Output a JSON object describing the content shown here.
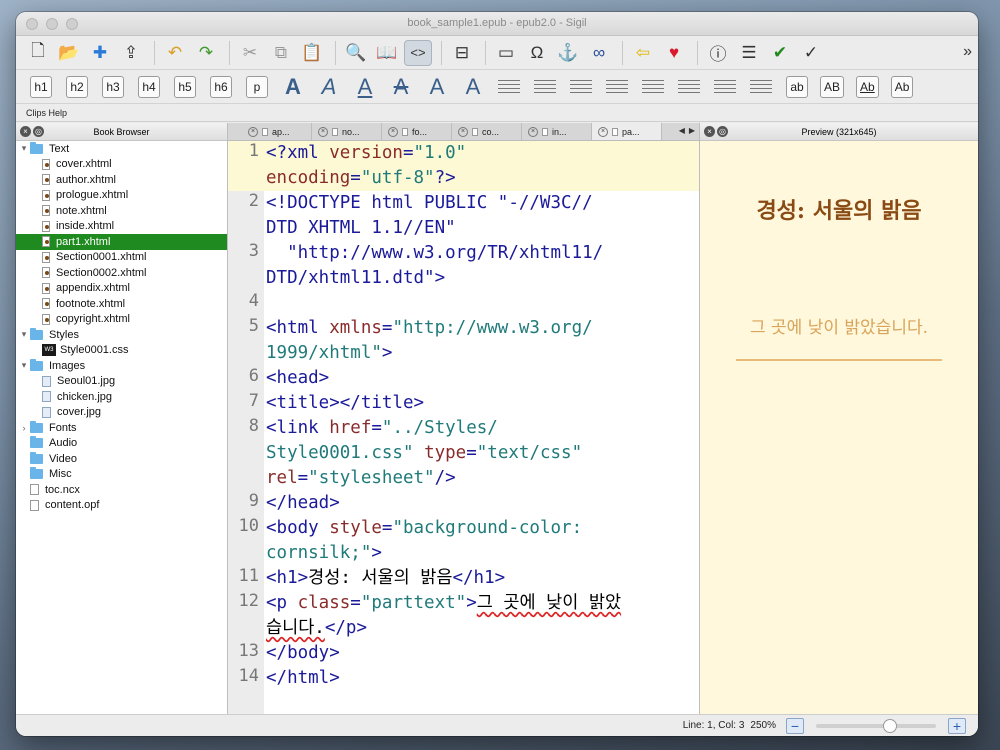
{
  "window": {
    "title": "book_sample1.epub - epub2.0 - Sigil"
  },
  "toolbar1": {
    "icons": [
      "new-file",
      "open-folder",
      "add-existing",
      "save",
      "undo",
      "redo",
      "cut",
      "copy",
      "paste",
      "find",
      "book-view",
      "code-view",
      "split-view",
      "insert-image",
      "special-char",
      "anchor",
      "link",
      "back-arrow",
      "heart",
      "metadata",
      "toc",
      "spellcheck",
      "validate"
    ],
    "active": "code-view",
    "overflow": "»"
  },
  "toolbar2": {
    "headings": [
      "h1",
      "h2",
      "h3",
      "h4",
      "h5",
      "h6",
      "p"
    ],
    "case_buttons": [
      "ab",
      "AB",
      "Ab",
      "Ab"
    ]
  },
  "clips_help": "Clips Help",
  "book_browser": {
    "title": "Book Browser",
    "tree": [
      {
        "label": "Text",
        "type": "folder",
        "expanded": true,
        "level": 0
      },
      {
        "label": "cover.xhtml",
        "type": "xhtml",
        "level": 1
      },
      {
        "label": "author.xhtml",
        "type": "xhtml",
        "level": 1
      },
      {
        "label": "prologue.xhtml",
        "type": "xhtml",
        "level": 1
      },
      {
        "label": "note.xhtml",
        "type": "xhtml",
        "level": 1
      },
      {
        "label": "inside.xhtml",
        "type": "xhtml",
        "level": 1
      },
      {
        "label": "part1.xhtml",
        "type": "xhtml",
        "level": 1,
        "selected": true
      },
      {
        "label": "Section0001.xhtml",
        "type": "xhtml",
        "level": 1
      },
      {
        "label": "Section0002.xhtml",
        "type": "xhtml",
        "level": 1
      },
      {
        "label": "appendix.xhtml",
        "type": "xhtml",
        "level": 1
      },
      {
        "label": "footnote.xhtml",
        "type": "xhtml",
        "level": 1
      },
      {
        "label": "copyright.xhtml",
        "type": "xhtml",
        "level": 1
      },
      {
        "label": "Styles",
        "type": "folder",
        "expanded": true,
        "level": 0
      },
      {
        "label": "Style0001.css",
        "type": "css",
        "level": 1
      },
      {
        "label": "Images",
        "type": "folder",
        "expanded": true,
        "level": 0
      },
      {
        "label": "Seoul01.jpg",
        "type": "image",
        "level": 1
      },
      {
        "label": "chicken.jpg",
        "type": "image",
        "level": 1
      },
      {
        "label": "cover.jpg",
        "type": "image",
        "level": 1
      },
      {
        "label": "Fonts",
        "type": "folder",
        "expanded": false,
        "level": 0
      },
      {
        "label": "Audio",
        "type": "folder",
        "level": 0
      },
      {
        "label": "Video",
        "type": "folder",
        "level": 0
      },
      {
        "label": "Misc",
        "type": "folder",
        "level": 0
      },
      {
        "label": "toc.ncx",
        "type": "file",
        "level": 0
      },
      {
        "label": "content.opf",
        "type": "file",
        "level": 0
      }
    ]
  },
  "editor": {
    "tabs": [
      "ap...",
      "no...",
      "fo...",
      "co...",
      "in...",
      "pa..."
    ],
    "active_tab": 5,
    "lines": [
      {
        "n": "1",
        "highlight": true,
        "segs": [
          [
            "tag",
            "<?xml "
          ],
          [
            "attr",
            "version"
          ],
          [
            "tag",
            "="
          ],
          [
            "val",
            "\"1.0\""
          ],
          [
            "plain",
            "\n"
          ],
          [
            "attr",
            "encoding"
          ],
          [
            "tag",
            "="
          ],
          [
            "val",
            "\"utf-8\""
          ],
          [
            "tag",
            "?>"
          ]
        ]
      },
      {
        "n": "2",
        "segs": [
          [
            "tag",
            "<!DOCTYPE html PUBLIC \"-//W3C//\nDTD XHTML 1.1//EN\""
          ]
        ]
      },
      {
        "n": "3",
        "segs": [
          [
            "tag",
            "  \"http://www.w3.org/TR/xhtml11/\nDTD/xhtml11.dtd\">"
          ]
        ]
      },
      {
        "n": "4",
        "segs": [
          [
            "plain",
            " "
          ]
        ]
      },
      {
        "n": "5",
        "segs": [
          [
            "tag",
            "<html "
          ],
          [
            "attr",
            "xmlns"
          ],
          [
            "tag",
            "="
          ],
          [
            "val",
            "\"http://www.w3.org/\n1999/xhtml\""
          ],
          [
            "tag",
            ">"
          ]
        ]
      },
      {
        "n": "6",
        "segs": [
          [
            "tag",
            "<head>"
          ]
        ]
      },
      {
        "n": "7",
        "segs": [
          [
            "tag",
            "<title></title>"
          ]
        ]
      },
      {
        "n": "8",
        "segs": [
          [
            "tag",
            "<link "
          ],
          [
            "attr",
            "href"
          ],
          [
            "tag",
            "="
          ],
          [
            "val",
            "\"../Styles/\nStyle0001.css\""
          ],
          [
            "tag",
            " "
          ],
          [
            "attr",
            "type"
          ],
          [
            "tag",
            "="
          ],
          [
            "val",
            "\"text/css\""
          ],
          [
            "plain",
            "\n"
          ],
          [
            "attr",
            "rel"
          ],
          [
            "tag",
            "="
          ],
          [
            "val",
            "\"stylesheet\""
          ],
          [
            "tag",
            "/>"
          ]
        ]
      },
      {
        "n": "9",
        "segs": [
          [
            "tag",
            "</head>"
          ]
        ]
      },
      {
        "n": "10",
        "segs": [
          [
            "tag",
            "<body "
          ],
          [
            "attr",
            "style"
          ],
          [
            "tag",
            "="
          ],
          [
            "val",
            "\"background-color:\ncornsilk;\""
          ],
          [
            "tag",
            ">"
          ]
        ]
      },
      {
        "n": "11",
        "segs": [
          [
            "tag",
            "<h1>"
          ],
          [
            "kor",
            "경성: 서울의 밝음"
          ],
          [
            "tag",
            "</h1>"
          ]
        ]
      },
      {
        "n": "12",
        "segs": [
          [
            "tag",
            "<p "
          ],
          [
            "attr",
            "class"
          ],
          [
            "tag",
            "="
          ],
          [
            "val",
            "\"parttext\""
          ],
          [
            "tag",
            ">"
          ],
          [
            "squig",
            "그 곳에 낮이 밝았\n습니다."
          ],
          [
            "tag",
            "</p>"
          ]
        ]
      },
      {
        "n": "13",
        "segs": [
          [
            "tag",
            "</body>"
          ]
        ]
      },
      {
        "n": "14",
        "segs": [
          [
            "tag",
            "</html>"
          ]
        ]
      }
    ]
  },
  "preview": {
    "title": "Preview (321x645)",
    "h1": "경성: 서울의 밝음",
    "p": "그 곳에 낮이 밝았습니다."
  },
  "status": {
    "position": "Line: 1, Col: 3",
    "zoom": "250%",
    "zoom_fraction": 0.62
  },
  "colors": {
    "selection": "#1f8a1f",
    "preview_bg": "#fff8dc",
    "h1_color": "#8a4a14",
    "p_color": "#d8a45a"
  }
}
